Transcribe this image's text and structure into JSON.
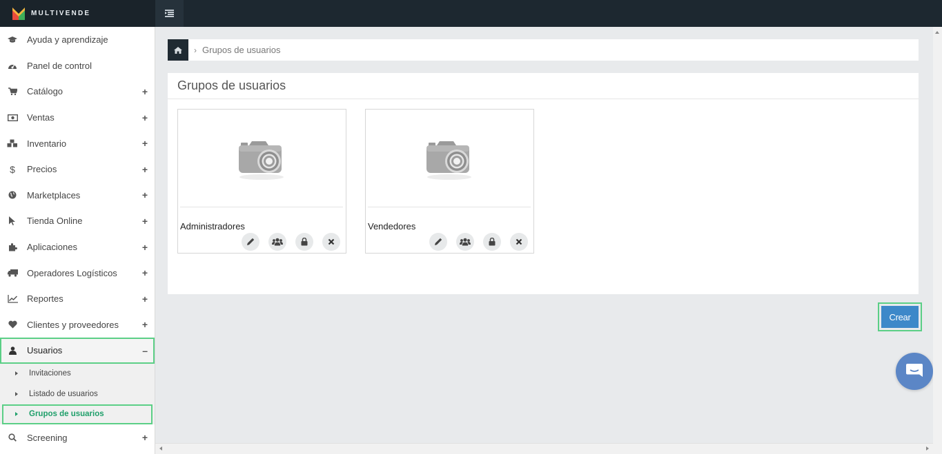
{
  "brand": {
    "name": "MULTIVENDE"
  },
  "sidebar": {
    "items": [
      {
        "label": "Ayuda y aprendizaje",
        "icon": "graduation-cap-icon",
        "expandable": false
      },
      {
        "label": "Panel de control",
        "icon": "dashboard-icon",
        "expandable": false
      },
      {
        "label": "Catálogo",
        "icon": "cart-icon",
        "expandable": true,
        "toggle": "+"
      },
      {
        "label": "Ventas",
        "icon": "money-icon",
        "expandable": true,
        "toggle": "+"
      },
      {
        "label": "Inventario",
        "icon": "cubes-icon",
        "expandable": true,
        "toggle": "+"
      },
      {
        "label": "Precios",
        "icon": "dollar-icon",
        "expandable": true,
        "toggle": "+"
      },
      {
        "label": "Marketplaces",
        "icon": "globe-icon",
        "expandable": true,
        "toggle": "+"
      },
      {
        "label": "Tienda Online",
        "icon": "cursor-icon",
        "expandable": true,
        "toggle": "+"
      },
      {
        "label": "Aplicaciones",
        "icon": "puzzle-icon",
        "expandable": true,
        "toggle": "+"
      },
      {
        "label": "Operadores Logísticos",
        "icon": "truck-icon",
        "expandable": true,
        "toggle": "+"
      },
      {
        "label": "Reportes",
        "icon": "line-chart-icon",
        "expandable": true,
        "toggle": "+"
      },
      {
        "label": "Clientes y proveedores",
        "icon": "heart-icon",
        "expandable": true,
        "toggle": "+"
      },
      {
        "label": "Usuarios",
        "icon": "user-icon",
        "expandable": true,
        "toggle": "–"
      }
    ],
    "submenu": [
      {
        "label": "Invitaciones"
      },
      {
        "label": "Listado de usuarios"
      },
      {
        "label": "Grupos de usuarios"
      }
    ],
    "after": {
      "label": "Screening",
      "icon": "search-icon",
      "toggle": "+"
    }
  },
  "breadcrumb": {
    "current": "Grupos de usuarios",
    "separator": "›"
  },
  "panel": {
    "title": "Grupos de usuarios",
    "groups": [
      {
        "name": "Administradores"
      },
      {
        "name": "Vendedores"
      }
    ]
  },
  "actions": {
    "create_label": "Crear"
  },
  "colors": {
    "topbar": "#1d2830",
    "accent_green": "#5bcf86",
    "active_text": "#1f9f6a",
    "create_button": "#3d88c9",
    "chat_bubble": "#5b86c6"
  }
}
